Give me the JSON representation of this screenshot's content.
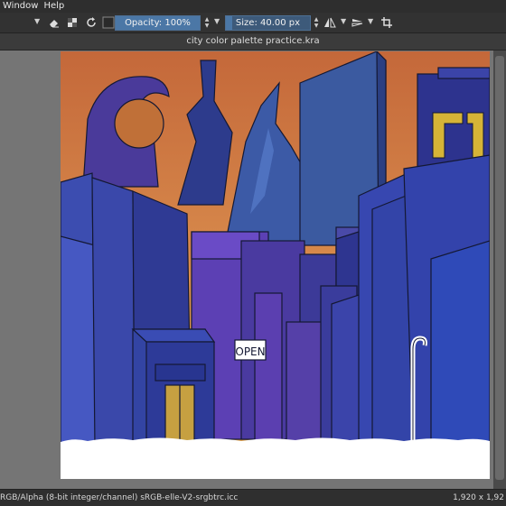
{
  "menu": {
    "window": "Window",
    "help": "Help"
  },
  "toolbar": {
    "opacity_label": "Opacity: 100%",
    "opacity_fraction": 1.0,
    "size_label": "Size: 40.00 px",
    "size_fraction": 0.08,
    "icons": [
      "eraser-icon",
      "alpha-lock-icon",
      "reload-preset-icon",
      "color-swatch-icon",
      "mirror-horizontal-icon",
      "mirror-vertical-icon",
      "crop-icon"
    ]
  },
  "document": {
    "title": "city color palette practice.kra"
  },
  "artwork": {
    "sign_text": "OPEN"
  },
  "status": {
    "color_info": "RGB/Alpha (8-bit integer/channel)  sRGB-elle-V2-srgbtrc.icc",
    "dimensions": "1,920 x 1,92"
  },
  "colors": {
    "sky_top": "#c96f3c",
    "sky_glow": "#e0a04c",
    "building_blue": "#3f4fb0",
    "building_dark": "#2c3690",
    "building_purple": "#4b3a98",
    "door": "#c6a041",
    "snow": "#ffffff",
    "accent_toolbar": "#4b77a6"
  }
}
